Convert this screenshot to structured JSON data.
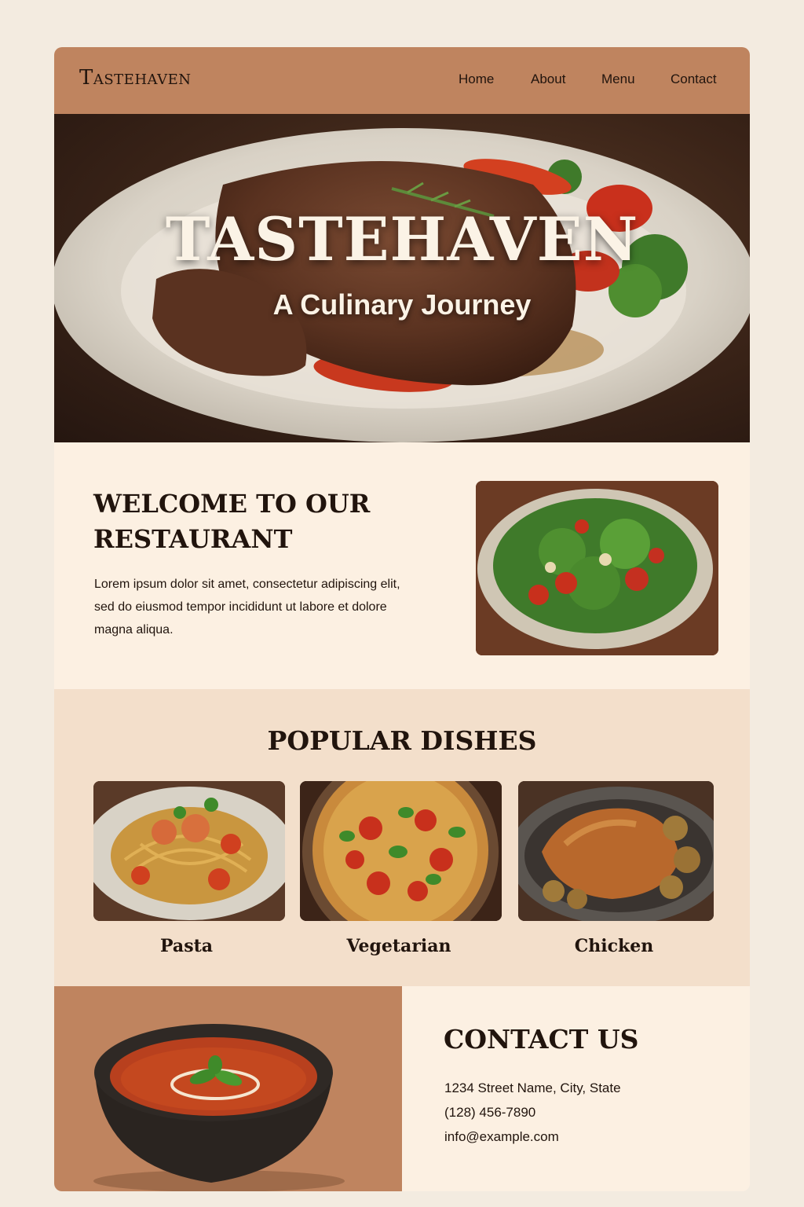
{
  "header": {
    "logo": "Tastehaven",
    "nav": [
      "Home",
      "About",
      "Menu",
      "Contact"
    ]
  },
  "hero": {
    "title": "TASTEHAVEN",
    "subtitle": "A Culinary Journey",
    "image_icon": "steak-plate-image"
  },
  "welcome": {
    "title": "WELCOME TO OUR RESTAURANT",
    "text": "Lorem ipsum dolor sit amet, consectetur adipiscing elit, sed do eiusmod tempor incididunt ut labore et dolore magna aliqua.",
    "image_icon": "salad-bowl-image"
  },
  "popular": {
    "title": "POPULAR DISHES",
    "dishes": [
      {
        "label": "Pasta",
        "image_icon": "pasta-image"
      },
      {
        "label": "Vegetarian",
        "image_icon": "pizza-image"
      },
      {
        "label": "Chicken",
        "image_icon": "roast-chicken-image"
      }
    ]
  },
  "contact": {
    "title": "CONTACT US",
    "address": "1234 Street Name, City, State",
    "phone": "(128) 456-7890",
    "email": "info@example.com",
    "image_icon": "tomato-soup-image"
  },
  "colors": {
    "page_bg": "#f3ebe0",
    "header_bg": "#bf845f",
    "content_bg": "#fcf0e2",
    "popular_bg": "#f3dfcb",
    "text_dark": "#21140d",
    "hero_text": "#fbf3e6"
  }
}
